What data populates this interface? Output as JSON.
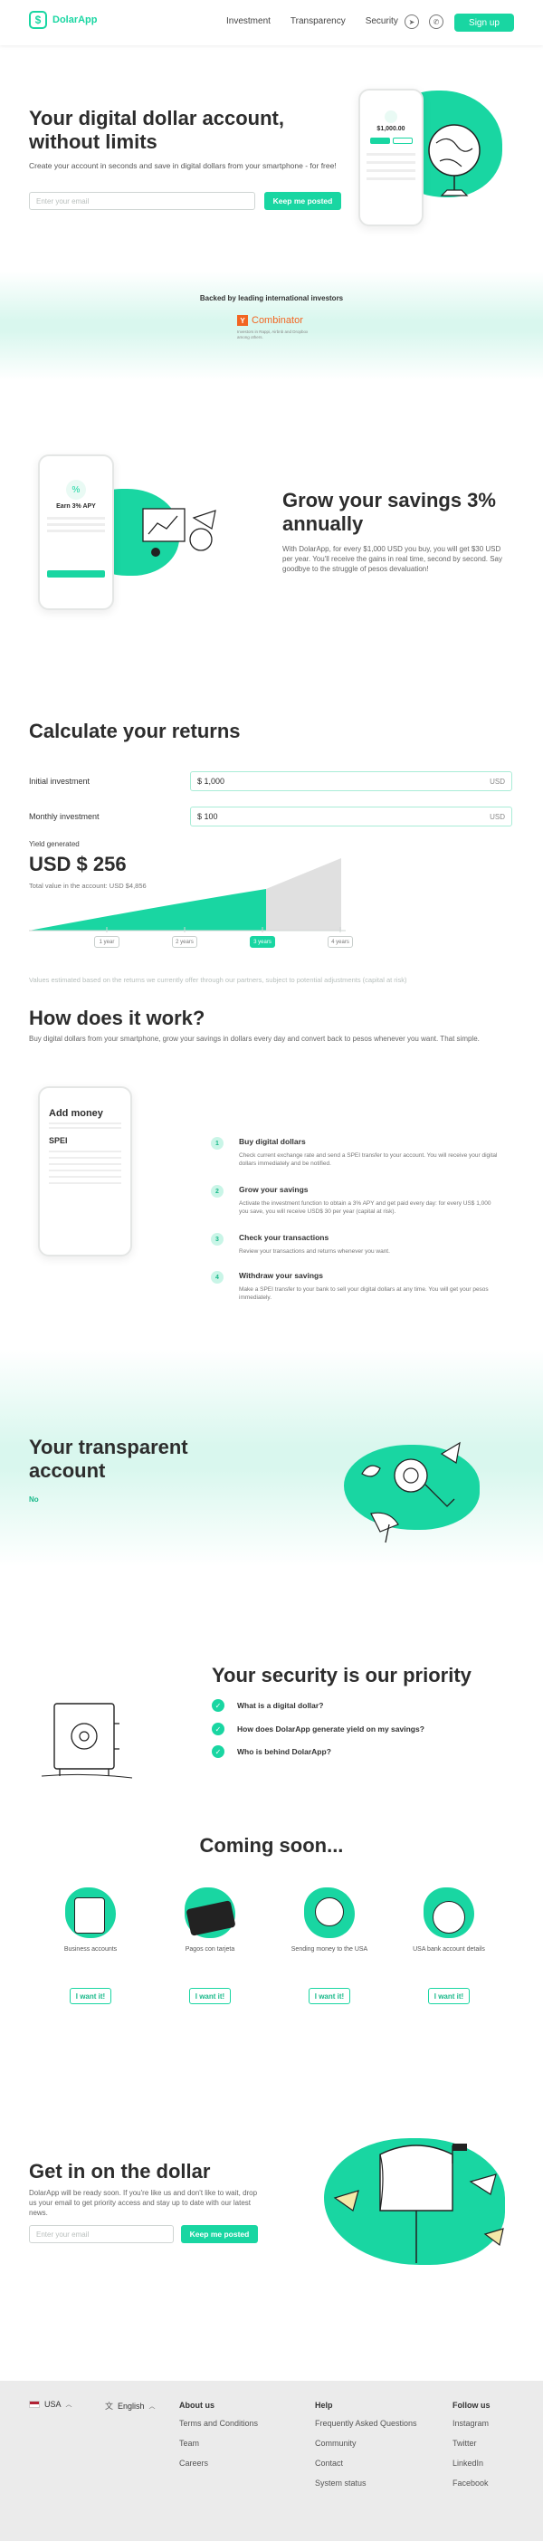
{
  "header": {
    "logo_text": "DolarApp",
    "nav": [
      "Investment",
      "Transparency",
      "Security"
    ],
    "social_icons": [
      "telegram-icon",
      "whatsapp-icon"
    ],
    "signup_label": "Sign up"
  },
  "hero": {
    "title": "Your digital dollar account, without limits",
    "subtitle": "Create your account in seconds and save in digital dollars from your smartphone - for free!",
    "email_placeholder": "Enter your email",
    "cta_label": "Keep me posted",
    "phone_balance": "$1,000.00"
  },
  "investors": {
    "label": "Backed by leading international investors",
    "yc_letter": "Y",
    "yc_name": "Combinator",
    "yc_note": "Investors in Rappi, Airbnb and Dropbox among others."
  },
  "savings": {
    "title": "Grow your savings 3% annually",
    "text": "With DolarApp, for every $1,000 USD you buy, you will get $30 USD per year. You'll receive the gains in real time, second by second. Say goodbye to the struggle of pesos devaluation!",
    "phone_label": "Earn 3% APY"
  },
  "calculator": {
    "title": "Calculate your returns",
    "initial_label": "Initial investment",
    "initial_value": "$ 1,000",
    "monthly_label": "Monthly investment",
    "monthly_value": "$ 100",
    "currency": "USD",
    "yield_label": "Yield generated",
    "yield_value": "USD $ 256",
    "total_label": "Total value in the account: USD $4,856",
    "years": [
      "1 year",
      "2 years",
      "3 years",
      "4 years"
    ],
    "selected_year_index": 2,
    "disclaimer": "Values estimated based on the returns we currently offer through our partners, subject to potential adjustments (capital at risk)"
  },
  "how": {
    "title": "How does it work?",
    "subtitle": "Buy digital dollars from your smartphone, grow your savings in dollars every day and convert back to pesos whenever you want. That simple.",
    "phone_title": "Add money",
    "phone_brand": "SPEI",
    "steps": [
      {
        "num": "1",
        "title": "Buy digital dollars",
        "desc": "Check current exchange rate and send a SPEI transfer to your account. You will receive your digital dollars immediately and be notified."
      },
      {
        "num": "2",
        "title": "Grow your savings",
        "desc": "Activate the investment function to obtain a 3% APY and get paid every day: for every US$ 1,000 you save, you will receive USD$ 30 per year (capital at risk)."
      },
      {
        "num": "3",
        "title": "Check your transactions",
        "desc": "Review your transactions and returns whenever you want."
      },
      {
        "num": "4",
        "title": "Withdraw your savings",
        "desc": "Make a SPEI transfer to your bank to sell your digital dollars at any time. You will get your pesos immediately."
      }
    ]
  },
  "transparent": {
    "title": "Your transparent account",
    "tag": "No"
  },
  "security": {
    "title": "Your security is our priority",
    "faq": [
      "What is a digital dollar?",
      "How does DolarApp generate yield on my savings?",
      "Who is behind DolarApp?"
    ]
  },
  "coming": {
    "title": "Coming soon...",
    "items": [
      "Business accounts",
      "Pagos con tarjeta",
      "Sending money to the USA",
      "USA bank account details"
    ],
    "button_label": "I want it!"
  },
  "getin": {
    "title": "Get in on the dollar",
    "text": "DolarApp will be ready soon. If you're like us and don't like to wait, drop us your email to get priority access and stay up to date with our latest news.",
    "email_placeholder": "Enter your email",
    "cta_label": "Keep me posted"
  },
  "footer": {
    "country": "USA",
    "language": "English",
    "about": {
      "title": "About us",
      "links": [
        "Terms and Conditions",
        "Team",
        "Careers"
      ]
    },
    "help": {
      "title": "Help",
      "links": [
        "Frequently Asked Questions",
        "Community",
        "Contact",
        "System status"
      ]
    },
    "follow": {
      "title": "Follow us",
      "links": [
        "Instagram",
        "Twitter",
        "LinkedIn",
        "Facebook"
      ]
    }
  },
  "colors": {
    "accent": "#19d6a2",
    "mint_band": "#d9f7ee",
    "footer_bg": "#ebebeb"
  }
}
